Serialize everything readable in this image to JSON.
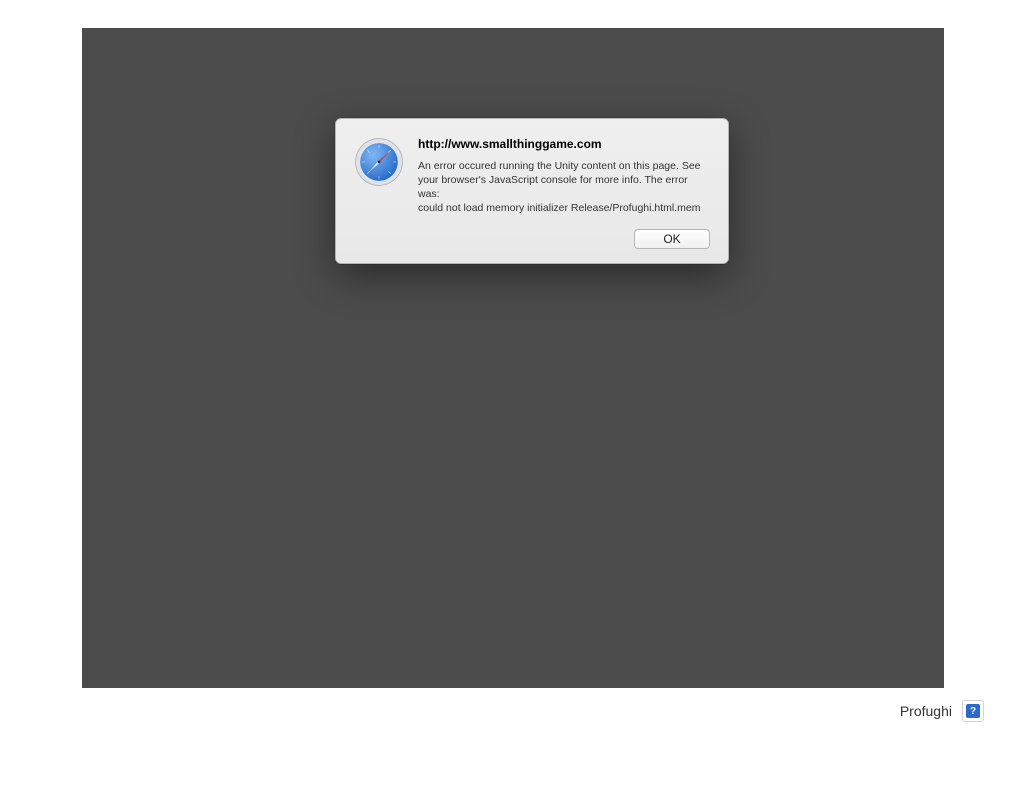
{
  "dialog": {
    "title": "http://www.smallthinggame.com",
    "message": "An error occured running the Unity content on this page. See your browser's JavaScript console for more info. The error was:\ncould not load memory initializer Release/Profughi.html.mem",
    "ok_label": "OK"
  },
  "footer": {
    "title": "Profughi",
    "badge_char": "?"
  }
}
